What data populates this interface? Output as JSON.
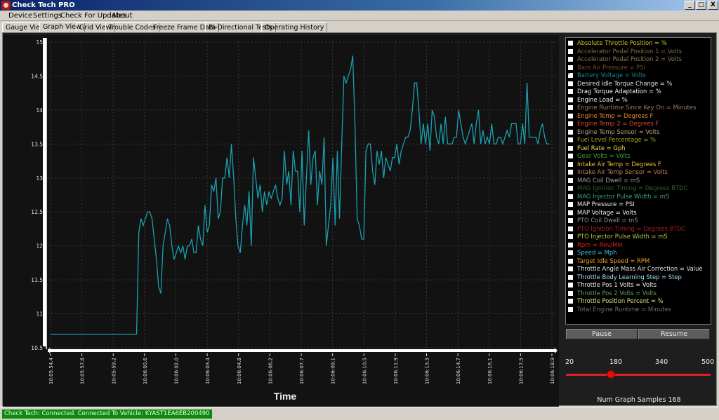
{
  "window": {
    "title": "Check Tech PRO",
    "min": "_",
    "max": "□",
    "close": "X"
  },
  "menu": [
    "Device",
    "Settings",
    "Check For Updates",
    "About"
  ],
  "tabs": [
    "Gauge View",
    "Graph View",
    "Grid View",
    "Trouble Codes",
    "Freeze Frame Data",
    "Bi-Directional Tests",
    "Operating History"
  ],
  "active_tab": "Graph View",
  "chart_data": {
    "type": "line",
    "xlabel": "Time",
    "ylabel": "",
    "ylim": [
      10.5,
      15
    ],
    "y_ticks": [
      "15",
      "14.5",
      "14",
      "13.5",
      "13",
      "12.5",
      "12",
      "11.5",
      "11",
      "10.5"
    ],
    "x_ticks": [
      "10:05:54.4",
      "10:05:57.8",
      "10:05:59.2",
      "10:06:00.6",
      "10:06:02.0",
      "10:06:03.4",
      "10:06:04.8",
      "10:06:06.2",
      "10:06:07.7",
      "10:06:09.1",
      "10:06:10.5",
      "10:06:11.9",
      "10:06:13.3",
      "10:06:14.7",
      "10:06:16.1",
      "10:06:17.5",
      "10:06:18.9"
    ],
    "grid": true,
    "line_color": "#1aa0b0",
    "series": [
      {
        "values": [
          10.7,
          10.7,
          10.7,
          10.7,
          10.7,
          10.7,
          10.7,
          10.7,
          10.7,
          10.7,
          10.7,
          10.7,
          10.7,
          10.7,
          10.7,
          10.7,
          10.7,
          10.7,
          10.7,
          10.7,
          10.7,
          10.7,
          10.7,
          10.7,
          10.7,
          10.7,
          10.7,
          10.7,
          10.7,
          10.7,
          10.7,
          10.7,
          10.7,
          10.7,
          10.7,
          10.7,
          10.7,
          10.7,
          10.7,
          10.7,
          12.2,
          12.4,
          12.3,
          12.4,
          12.5,
          12.5,
          12.4,
          12.1,
          11.8,
          11.4,
          11.3,
          12.0,
          12.2,
          12.4,
          12.3,
          12.0,
          11.8,
          11.9,
          12.0,
          11.9,
          12.0,
          11.8,
          12.0,
          12.0,
          12.1,
          11.9,
          11.9,
          12.3,
          12.1,
          12.0,
          12.6,
          12.2,
          12.3,
          12.9,
          12.8,
          13.0,
          12.4,
          12.5,
          13.0,
          13.0,
          13.3,
          13.0,
          13.5,
          13.0,
          12.4,
          12.0,
          11.9,
          12.3,
          12.6,
          12.3,
          12.8,
          12.0,
          13.3,
          13.0,
          12.7,
          12.9,
          12.5,
          12.8,
          12.6,
          12.8,
          12.7,
          12.8,
          12.9,
          12.7,
          12.6,
          12.7,
          13.4,
          12.9,
          13.1,
          12.6,
          13.4,
          13.1,
          13.1,
          12.5,
          13.4,
          12.3,
          13.0,
          13.7,
          12.9,
          13.3,
          13.4,
          12.6,
          13.1,
          12.9,
          13.6,
          12.0,
          12.3,
          12.6,
          13.3,
          12.3,
          13.4,
          12.4,
          13.5,
          14.5,
          14.4,
          14.5,
          14.6,
          14.8,
          13.8,
          12.4,
          12.3,
          12.1,
          12.1,
          13.4,
          13.5,
          13.5,
          13.1,
          12.9,
          13.4,
          13.2,
          13.4,
          13.0,
          13.3,
          13.2,
          13.1,
          13.3,
          13.3,
          13.5,
          13.2,
          13.4,
          13.5,
          13.6,
          13.6,
          13.7,
          14.0,
          14.4,
          14.4,
          14.0,
          13.5,
          13.8,
          13.5,
          13.8,
          13.4,
          14.0,
          13.9,
          13.6,
          13.5,
          13.8,
          13.5,
          13.9,
          13.5,
          13.5,
          13.5,
          13.6,
          13.6,
          14.0,
          13.8,
          13.6,
          13.5,
          13.6,
          13.7,
          13.8,
          13.5,
          13.8,
          14.0,
          13.5,
          13.7,
          13.5,
          13.6,
          13.5,
          13.8,
          13.5,
          13.5,
          13.6,
          13.6,
          13.5,
          13.6,
          13.7,
          13.6,
          13.8,
          13.8,
          13.8,
          13.5,
          13.5,
          13.8,
          13.5,
          14.4,
          13.6,
          13.6,
          13.6,
          13.6,
          13.5,
          13.7,
          13.8,
          13.6,
          13.5,
          13.5
        ]
      }
    ]
  },
  "legend": [
    {
      "label": "Absolute Throttle Position = %",
      "color": "#d8c020",
      "checked": false
    },
    {
      "label": "Accelerator Pedal Position 1 = Volts",
      "color": "#7a7040",
      "checked": false
    },
    {
      "label": "Accelerator Pedal Position 2 = Volts",
      "color": "#8a7a50",
      "checked": false
    },
    {
      "label": "Baro Air Pressure = PSI",
      "color": "#7a4a20",
      "checked": false
    },
    {
      "label": "Battery Voltage = Volts",
      "color": "#1a8a8a",
      "checked": true
    },
    {
      "label": "Desired Idle Torque Change = %",
      "color": "#e0e0e0",
      "checked": false
    },
    {
      "label": "Drag Torque Adaptation = %",
      "color": "#f0f0f0",
      "checked": false
    },
    {
      "label": "Engine Load = %",
      "color": "#f0f0f0",
      "checked": false
    },
    {
      "label": "Engine Runtime Since Key On = Minutes",
      "color": "#a07a60",
      "checked": false
    },
    {
      "label": "Engine Temp = Degrees F",
      "color": "#e08a30",
      "checked": false
    },
    {
      "label": "Engine Temp 2 = Degrees F",
      "color": "#d84a30",
      "checked": false
    },
    {
      "label": "Engine Temp Sensor = Volts",
      "color": "#c0a080",
      "checked": false
    },
    {
      "label": "Fuel Level Percentage = %",
      "color": "#a0a020",
      "checked": false
    },
    {
      "label": "Fuel Rate = Gph",
      "color": "#e0e060",
      "checked": false
    },
    {
      "label": "Gear Volts = Volts",
      "color": "#40a040",
      "checked": false
    },
    {
      "label": "Intake Air Temp = Degrees F",
      "color": "#f0c040",
      "checked": false
    },
    {
      "label": "Intake Air Temp Sensor = Volts",
      "color": "#c08060",
      "checked": false
    },
    {
      "label": "MAG Coil Dwell = mS",
      "color": "#a0a0a0",
      "checked": false
    },
    {
      "label": "MAG Ignition Timing = Degrees BTDC",
      "color": "#306030",
      "checked": false
    },
    {
      "label": "MAG Injector Pulse Width = mS",
      "color": "#40a070",
      "checked": false
    },
    {
      "label": "MAP Pressure = PSI",
      "color": "#f0f0f0",
      "checked": false
    },
    {
      "label": "MAP Voltage = Volts",
      "color": "#f0f0f0",
      "checked": false
    },
    {
      "label": "PTO Coil Dwell = mS",
      "color": "#909090",
      "checked": false
    },
    {
      "label": "PTO Ignition Timing = Degrees BTDC",
      "color": "#a02020",
      "checked": false
    },
    {
      "label": "PTO Injector Pulse Width = mS",
      "color": "#c0c040",
      "checked": false
    },
    {
      "label": "Rpm = Rev/Min",
      "color": "#e02020",
      "checked": false
    },
    {
      "label": "Speed = Mph",
      "color": "#40c0e0",
      "checked": false
    },
    {
      "label": "Target Idle Speed = RPM",
      "color": "#f0a020",
      "checked": false
    },
    {
      "label": "Throttle Angle Mass Air Correction = Value",
      "color": "#e0e0e0",
      "checked": false
    },
    {
      "label": "Throttle Body Learning Step = Step",
      "color": "#a0e0f0",
      "checked": false
    },
    {
      "label": "Throttle Pos 1 Volts = Volts",
      "color": "#f0f0f0",
      "checked": false
    },
    {
      "label": "Throttle Pos 2 Volts = Volts",
      "color": "#60a060",
      "checked": false
    },
    {
      "label": "Throttle Position Percent = %",
      "color": "#e0e080",
      "checked": false
    },
    {
      "label": "Total Engine Runtime = Minutes",
      "color": "#707070",
      "checked": false
    }
  ],
  "controls": {
    "pause": "Pause",
    "resume": "Resume"
  },
  "slider": {
    "ticks": [
      "20",
      "180",
      "340",
      "500"
    ],
    "value": 168,
    "min": 20,
    "max": 500
  },
  "num_samples_text": "Num Graph Samples 168",
  "status": "Check Tech: Connected. Connected To Vehicle: KYAST1EA6EB200490"
}
